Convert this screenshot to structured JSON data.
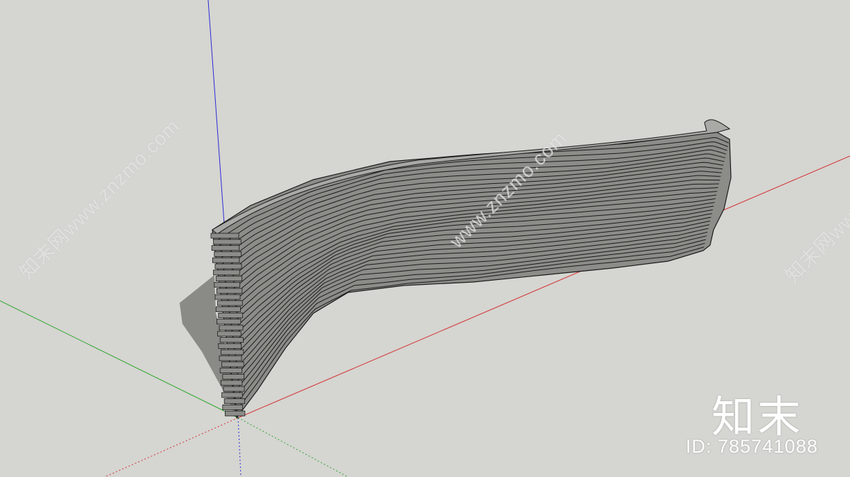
{
  "viewport": {
    "background_color": "#d5d5d1",
    "axes": {
      "x_color": "#d43030",
      "y_color": "#2aa62a",
      "z_color": "#2a2ad8"
    },
    "model": {
      "face_color": "#8c8c88",
      "top_color": "#a9a9a5",
      "edge_color": "#1a1a1a",
      "shadow_color": "#8a8a86"
    }
  },
  "watermarks": [
    "知末网www.znzmo.com",
    "www.znzmo.com",
    "知末网www.znzm"
  ],
  "logo": "知末",
  "model_id": "ID: 785741088"
}
